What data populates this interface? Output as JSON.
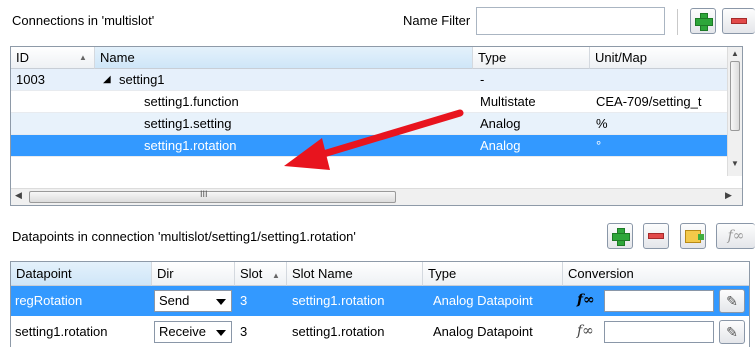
{
  "header": {
    "connections_title": "Connections in 'multislot'",
    "name_filter_label": "Name Filter",
    "name_filter_value": ""
  },
  "connections_table": {
    "columns": [
      "ID",
      "Name",
      "Type",
      "Unit/Map"
    ],
    "rows": [
      {
        "id": "1003",
        "name": "setting1",
        "type": "-",
        "unit": ""
      },
      {
        "id": "",
        "name": "setting1.function",
        "type": "Multistate",
        "unit": "CEA-709/setting_t"
      },
      {
        "id": "",
        "name": "setting1.setting",
        "type": "Analog",
        "unit": "%"
      },
      {
        "id": "",
        "name": "setting1.rotation",
        "type": "Analog",
        "unit": "°"
      }
    ],
    "tree_toggle": "◢",
    "scroll_marker": "III"
  },
  "datapoints": {
    "title": "Datapoints in connection 'multislot/setting1/setting1.rotation'",
    "columns": [
      "Datapoint",
      "Dir",
      "Slot",
      "Slot Name",
      "Type",
      "Conversion"
    ],
    "rows": [
      {
        "datapoint": "regRotation",
        "dir": "Send",
        "slot": "3",
        "slot_name": "setting1.rotation",
        "type": "Analog Datapoint",
        "conversion": ""
      },
      {
        "datapoint": "setting1.rotation",
        "dir": "Receive",
        "slot": "3",
        "slot_name": "setting1.rotation",
        "type": "Analog Datapoint",
        "conversion": ""
      }
    ],
    "fx_label": "f∞"
  },
  "colors": {
    "selection": "#3399ff",
    "alt_row": "#e8f2fb",
    "arrow": "#e8141e"
  }
}
